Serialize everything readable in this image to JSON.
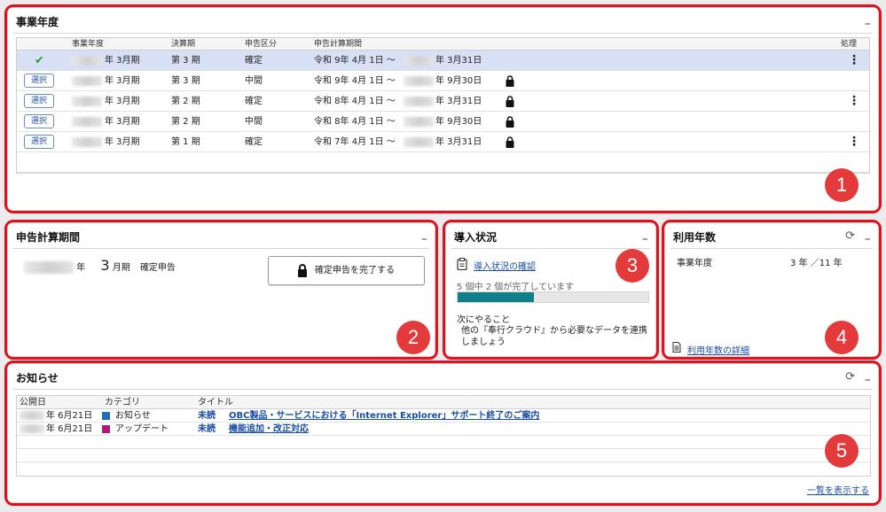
{
  "fiscal_panel": {
    "title": "事業年度",
    "minimize": "_",
    "columns": [
      "事業年度",
      "決算期",
      "申告区分",
      "申告計算期間",
      "処理"
    ],
    "select_label": "選択",
    "rows": [
      {
        "year_suffix": "年 3月期",
        "term": "第 3 期",
        "type": "確定",
        "start": "令和 9年 4月 1日 ～",
        "end": "年 3月31日",
        "selected": true,
        "locked": false,
        "menu": true
      },
      {
        "year_suffix": "年 3月期",
        "term": "第 3 期",
        "type": "中間",
        "start": "令和 9年 4月 1日 ～",
        "end": "年 9月30日",
        "selected": false,
        "locked": true,
        "menu": false
      },
      {
        "year_suffix": "年 3月期",
        "term": "第 2 期",
        "type": "確定",
        "start": "令和 8年 4月 1日 ～",
        "end": "年 3月31日",
        "selected": false,
        "locked": true,
        "menu": true
      },
      {
        "year_suffix": "年 3月期",
        "term": "第 2 期",
        "type": "中間",
        "start": "令和 8年 4月 1日 ～",
        "end": "年 9月30日",
        "selected": false,
        "locked": true,
        "menu": false
      },
      {
        "year_suffix": "年 3月期",
        "term": "第 1 期",
        "type": "確定",
        "start": "令和 7年 4月 1日 ～",
        "end": "年 3月31日",
        "selected": false,
        "locked": true,
        "menu": true
      }
    ]
  },
  "period_panel": {
    "title": "申告計算期間",
    "minimize": "_",
    "year_suffix": "年",
    "month": "3",
    "month_suffix": "月期",
    "type": "確定申告",
    "complete_button": "確定申告を完了する"
  },
  "setup_panel": {
    "title": "導入状況",
    "minimize": "_",
    "check_link": "導入状況の確認",
    "progress_text": "5 個中 2 個が完了しています",
    "progress_fraction": 0.4,
    "next_label": "次にやること",
    "next_text": "他の『奉行クラウド』から必要なデータを連携しましょう"
  },
  "usage_panel": {
    "title": "利用年数",
    "minimize": "_",
    "label": "事業年度",
    "value": "3 年 ／11 年",
    "detail_link": "利用年数の詳細"
  },
  "news_panel": {
    "title": "お知らせ",
    "minimize": "_",
    "columns": [
      "公開日",
      "カテゴリ",
      "タイトル"
    ],
    "rows": [
      {
        "date": "年 6月21日",
        "category": "お知らせ",
        "category_color": "#1f6fb8",
        "status": "未読",
        "title": "OBC製品・サービスにおける「Internet Explorer」サポート終了のご案内"
      },
      {
        "date": "年 6月21日",
        "category": "アップデート",
        "category_color": "#b0197a",
        "status": "未読",
        "title": "機能追加・改正対応"
      }
    ],
    "show_all": "一覧を表示する"
  },
  "badges": [
    "1",
    "2",
    "3",
    "4",
    "5"
  ],
  "colors": {
    "accent_red": "#e3101d",
    "progress": "#117f8a",
    "link": "#1a4ea3"
  }
}
